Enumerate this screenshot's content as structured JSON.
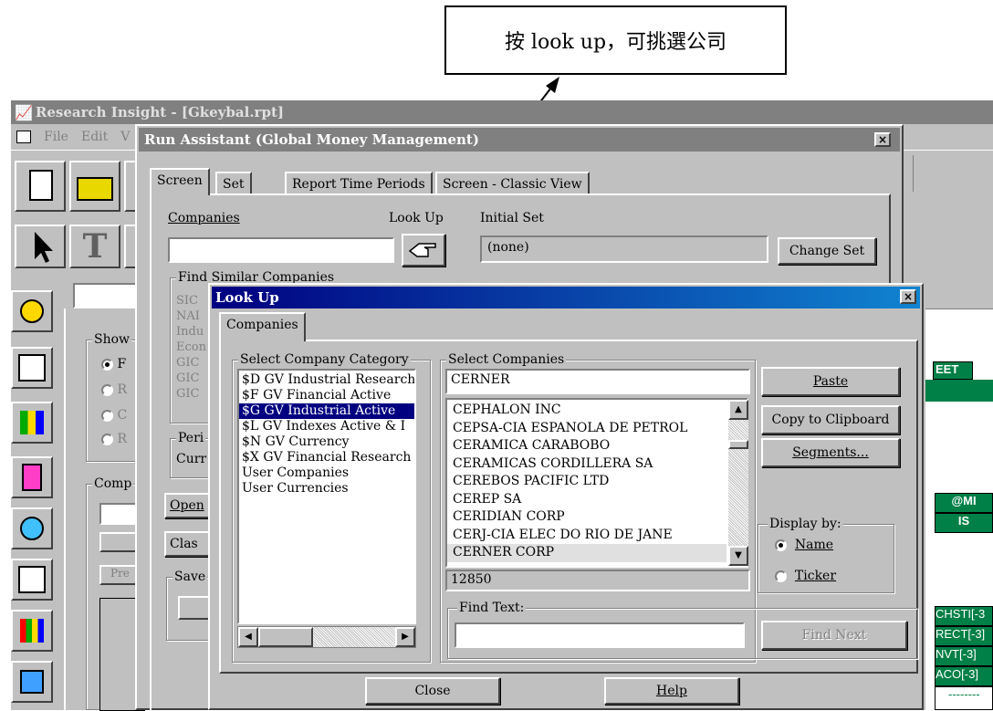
{
  "callout": {
    "text": "按 look up，可挑選公司"
  },
  "app": {
    "title": "Research Insight - [Gkeybal.rpt]",
    "menu": [
      "File",
      "Edit",
      "V"
    ]
  },
  "background_panel": {
    "show_label": "Show",
    "radio_letters": [
      "F",
      "R",
      "C",
      "R"
    ],
    "comp_label": "Comp",
    "buttons": [
      "Open",
      "Clas",
      "Pre",
      "Save"
    ]
  },
  "right_panel": {
    "header": "EET",
    "mi_label": "@MI",
    "is_label": "IS",
    "rows": [
      "CHSTI[-3",
      "RECT[-3]",
      "NVT[-3]",
      "ACO[-3]",
      "--------"
    ]
  },
  "run_assistant": {
    "title": "Run Assistant   (Global Money Management)",
    "close_glyph": "×",
    "tabs": [
      "Screen",
      "Set",
      "Report Time Periods",
      "Screen - Classic View"
    ],
    "companies_label": "Companies",
    "lookup_label": "Look Up",
    "initial_set_label": "Initial Set",
    "initial_set_value": "(none)",
    "change_set_button": "Change Set",
    "find_similar_label": "Find Similar Companies",
    "find_similar_items": [
      "SIC",
      "NAI",
      "Indu",
      "Econ",
      "GIC",
      "GIC",
      "GIC"
    ],
    "period_label": "Peri",
    "period_value": "Curr"
  },
  "lookup": {
    "title": "Look Up",
    "close_glyph": "×",
    "tab": "Companies",
    "category_group_label": "Select Company Category",
    "categories": [
      "$D GV Industrial Research",
      "$F GV Financial Active",
      "$G GV Industrial Active",
      "$L GV Indexes Active & I",
      "$N GV Currency",
      "$X GV Financial Research",
      "User Companies",
      "User Currencies"
    ],
    "selected_category_index": 2,
    "companies_group_label": "Select Companies",
    "search_value": "CERNER",
    "companies": [
      "CEPHALON INC",
      "CEPSA-CIA ESPANOLA DE PETROL",
      "CERAMICA CARABOBO",
      "CERAMICAS CORDILLERA SA",
      "CEREBOS PACIFIC LTD",
      "CEREP SA",
      "CERIDIAN CORP",
      "CERJ-CIA ELEC DO RIO DE JANE",
      "CERNER CORP"
    ],
    "selected_company_index": 8,
    "company_code": "12850",
    "paste_button": "Paste",
    "copy_button": "Copy to Clipboard",
    "segments_button": "Segments...",
    "display_by_label": "Display by:",
    "display_options": [
      "Name",
      "Ticker"
    ],
    "display_selected": "Name",
    "find_text_label": "Find Text:",
    "find_text_value": "",
    "find_next_button": "Find Next",
    "close_button": "Close",
    "help_button": "Help"
  }
}
